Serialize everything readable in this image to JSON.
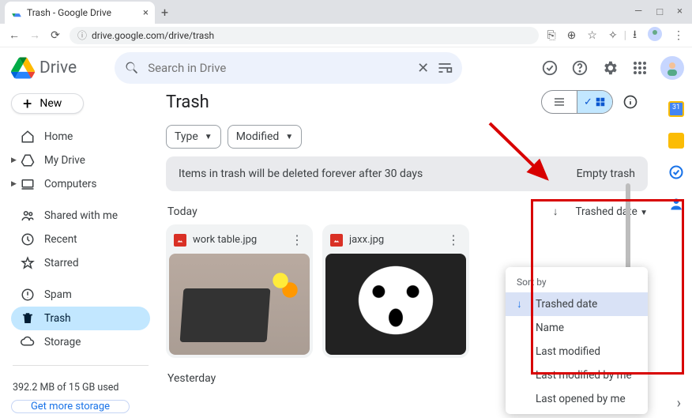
{
  "browser": {
    "tab_title": "Trash - Google Drive",
    "url": "drive.google.com/drive/trash"
  },
  "brand": "Drive",
  "search": {
    "placeholder": "Search in Drive"
  },
  "new_button": "New",
  "nav": {
    "home": "Home",
    "my_drive": "My Drive",
    "computers": "Computers",
    "shared": "Shared with me",
    "recent": "Recent",
    "starred": "Starred",
    "spam": "Spam",
    "trash": "Trash",
    "storage": "Storage"
  },
  "storage": {
    "text": "392.2 MB of 15 GB used",
    "cta": "Get more storage"
  },
  "page": {
    "title": "Trash",
    "chips": {
      "type": "Type",
      "modified": "Modified"
    },
    "banner_msg": "Items in trash will be deleted forever after 30 days",
    "banner_action": "Empty trash"
  },
  "sections": {
    "today": "Today",
    "yesterday": "Yesterday"
  },
  "sort": {
    "current": "Trashed date",
    "header": "Sort by",
    "options": [
      "Trashed date",
      "Name",
      "Last modified",
      "Last modified by me",
      "Last opened by me"
    ]
  },
  "files": [
    {
      "name": "work table.jpg"
    },
    {
      "name": "jaxx.jpg"
    }
  ],
  "colors": {
    "accent": "#1a73e8",
    "annotation": "#d80000"
  }
}
